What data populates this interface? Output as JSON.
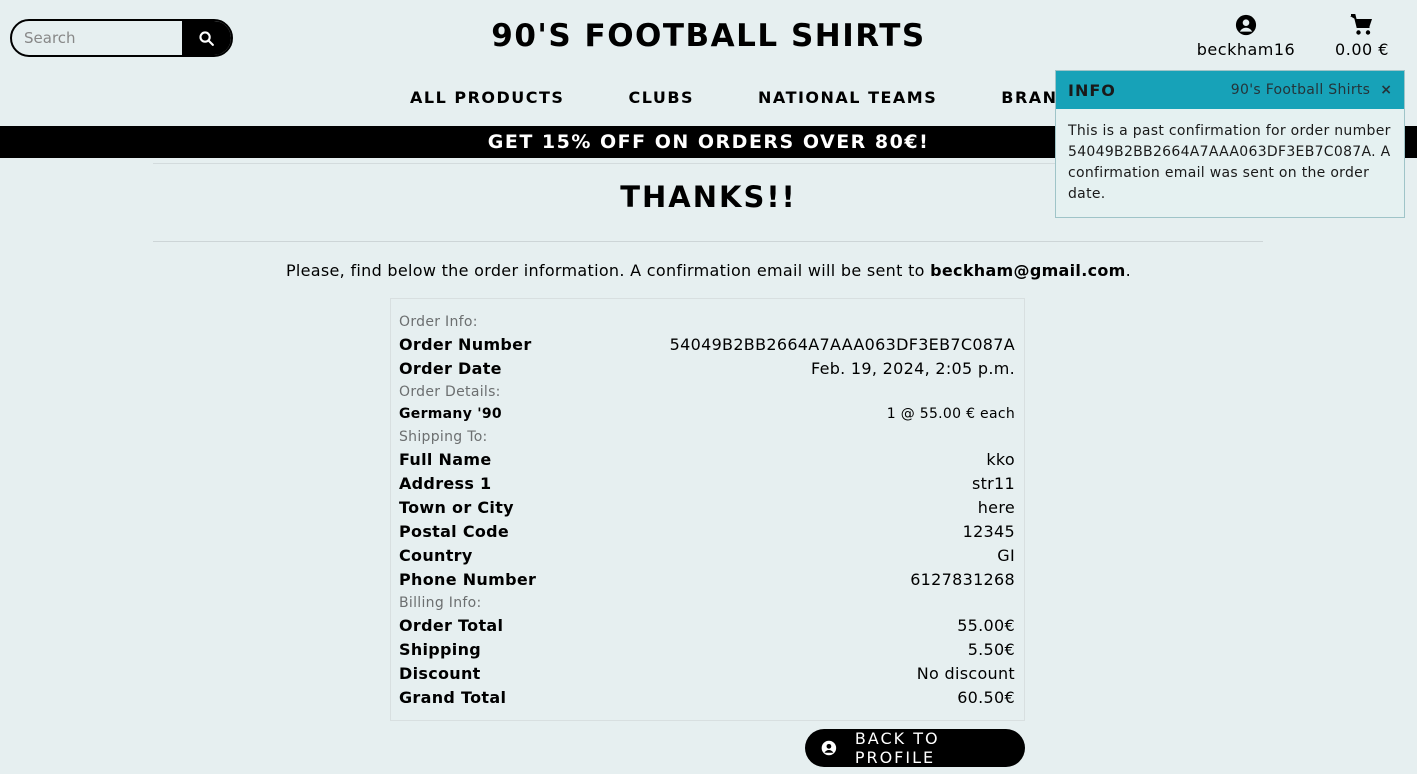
{
  "search": {
    "placeholder": "Search"
  },
  "header": {
    "title": "90'S FOOTBALL SHIRTS",
    "account_label": "beckham16",
    "bag_total": "0.00 €"
  },
  "nav": {
    "items": [
      "ALL PRODUCTS",
      "CLUBS",
      "NATIONAL TEAMS",
      "BRANDS"
    ]
  },
  "banner": {
    "text": "GET 15% OFF ON ORDERS OVER 80€!"
  },
  "main": {
    "heading": "THANKS!!",
    "intro_prefix": "Please, find below the order information. A confirmation email will be sent to ",
    "intro_email": "beckham@gmail.com",
    "intro_suffix": "."
  },
  "order": {
    "info_label": "Order Info:",
    "number_key": "Order Number",
    "number_val": "54049B2BB2664A7AAA063DF3EB7C087A",
    "date_key": "Order Date",
    "date_val": "Feb. 19, 2024, 2:05 p.m.",
    "details_label": "Order Details:",
    "item_name": "Germany '90",
    "item_qty": "1 @ 55.00 € each",
    "shipping_label": "Shipping To:",
    "full_name_key": "Full Name",
    "full_name_val": "kko",
    "address_key": "Address 1",
    "address_val": "str11",
    "town_key": "Town or City",
    "town_val": "here",
    "postal_key": "Postal Code",
    "postal_val": "12345",
    "country_key": "Country",
    "country_val": "GI",
    "phone_key": "Phone Number",
    "phone_val": "6127831268",
    "billing_label": "Billing Info:",
    "order_total_key": "Order Total",
    "order_total_val": "55.00€",
    "shipping_key": "Shipping",
    "shipping_val": "5.50€",
    "discount_key": "Discount",
    "discount_val": "No discount",
    "grand_total_key": "Grand Total",
    "grand_total_val": "60.50€"
  },
  "back_button": {
    "label": "BACK TO PROFILE"
  },
  "toast": {
    "title": "INFO",
    "source": "90's Football Shirts",
    "close": "×",
    "message": "This is a past confirmation for order number 54049B2BB2664A7AAA063DF3EB7C087A. A confirmation email was sent on the order date."
  },
  "colors": {
    "background": "#e6eff0",
    "toast_header": "#17a2b8",
    "button": "#000000"
  },
  "icons": [
    "search-icon",
    "user-circle-icon",
    "shopping-cart-icon",
    "close-icon"
  ]
}
